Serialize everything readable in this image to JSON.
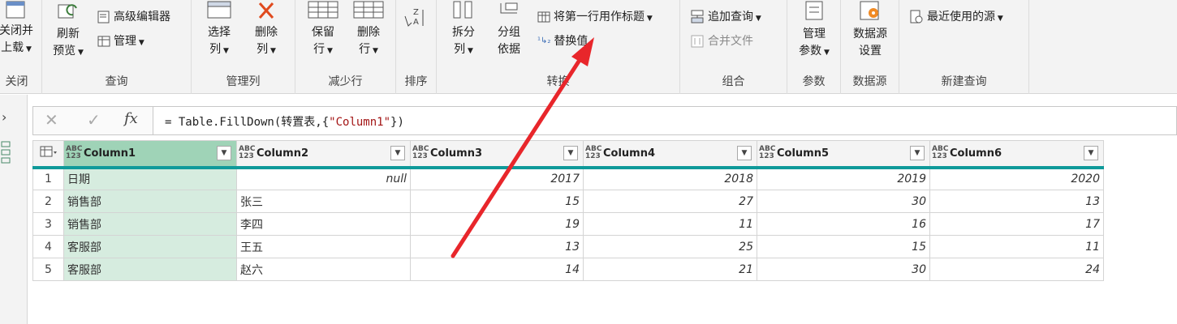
{
  "ribbon": {
    "close": {
      "label_1": "关闭并",
      "label_2": "上载",
      "group": "关闭"
    },
    "query": {
      "refresh_1": "刷新",
      "refresh_2": "预览",
      "advanced_editor": "高级编辑器",
      "manage": "管理",
      "group": "查询"
    },
    "manage_cols": {
      "choose_1": "选择",
      "choose_2": "列",
      "remove_1": "删除",
      "remove_2": "列",
      "group": "管理列"
    },
    "reduce_rows": {
      "keep_1": "保留",
      "keep_2": "行",
      "remove_1": "删除",
      "remove_2": "行",
      "group": "减少行"
    },
    "sort": {
      "group": "排序"
    },
    "transform": {
      "split_1": "拆分",
      "split_2": "列",
      "group_by_1": "分组",
      "group_by_2": "依据",
      "first_row_header": "将第一行用作标题",
      "replace_values": "替换值",
      "group": "转换"
    },
    "combine": {
      "append": "追加查询",
      "merge_files": "合并文件",
      "group": "组合"
    },
    "params": {
      "manage_1": "管理",
      "manage_2": "参数",
      "group": "参数"
    },
    "datasource": {
      "settings_1": "数据源",
      "settings_2": "设置",
      "group": "数据源"
    },
    "new_query": {
      "recent": "最近使用的源",
      "group": "新建查询"
    }
  },
  "formula": {
    "prefix": "= Table.FillDown(转置表,{",
    "string": "\"Column1\"",
    "suffix": "})"
  },
  "table": {
    "headers": [
      "Column1",
      "Column2",
      "Column3",
      "Column4",
      "Column5",
      "Column6"
    ],
    "type_top": "ABC",
    "type_bottom": "123",
    "rows": [
      {
        "n": "1",
        "c1": "日期",
        "c2": "null",
        "c3": "2017",
        "c4": "2018",
        "c5": "2019",
        "c6": "2020"
      },
      {
        "n": "2",
        "c1": "销售部",
        "c2": "张三",
        "c3": "15",
        "c4": "27",
        "c5": "30",
        "c6": "13"
      },
      {
        "n": "3",
        "c1": "销售部",
        "c2": "李四",
        "c3": "19",
        "c4": "11",
        "c5": "16",
        "c6": "17"
      },
      {
        "n": "4",
        "c1": "客服部",
        "c2": "王五",
        "c3": "13",
        "c4": "25",
        "c5": "15",
        "c6": "11"
      },
      {
        "n": "5",
        "c1": "客服部",
        "c2": "赵六",
        "c3": "14",
        "c4": "21",
        "c5": "30",
        "c6": "24"
      }
    ]
  },
  "colors": {
    "accent": "#0f9a9a",
    "selected_col": "#d6ecdf",
    "arrow": "#e8262b"
  },
  "icons": [
    "table-menu-icon",
    "fx-icon",
    "cancel-icon",
    "check-icon",
    "dropdown-icon"
  ]
}
